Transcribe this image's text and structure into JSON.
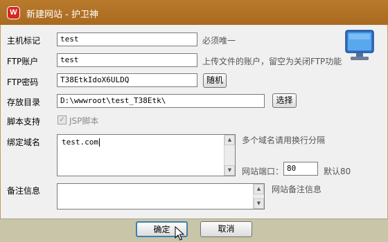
{
  "window": {
    "title": "新建网站 - 护卫神",
    "icon_letter": "W"
  },
  "form": {
    "hostname": {
      "label": "主机标记",
      "value": "test",
      "hint": "必须唯一"
    },
    "ftp_account": {
      "label": "FTP账户",
      "value": "test",
      "hint": "上传文件的账户，留空为关闭FTP功能"
    },
    "ftp_password": {
      "label": "FTP密码",
      "value": "T38EtkIdoX6ULDQ",
      "random_button": "随机"
    },
    "directory": {
      "label": "存放目录",
      "value": "D:\\wwwroot\\test_T38Etk\\",
      "choose_button": "选择"
    },
    "script": {
      "label": "脚本支持",
      "checkbox_label": "JSP脚本",
      "checked": true,
      "enabled": false
    },
    "domain": {
      "label": "绑定域名",
      "value": "test.com",
      "hint": "多个域名请用换行分隔"
    },
    "port": {
      "label": "网站端口：",
      "value": "80",
      "default_hint": "默认80"
    },
    "remark": {
      "label": "备注信息",
      "value": "",
      "hint": "网站备注信息"
    }
  },
  "footer": {
    "ok_label": "确定",
    "cancel_label": "取消"
  },
  "colors": {
    "titlebar": "#b07326",
    "footer": "#c8c5a8",
    "client": "#f0f0f0"
  }
}
